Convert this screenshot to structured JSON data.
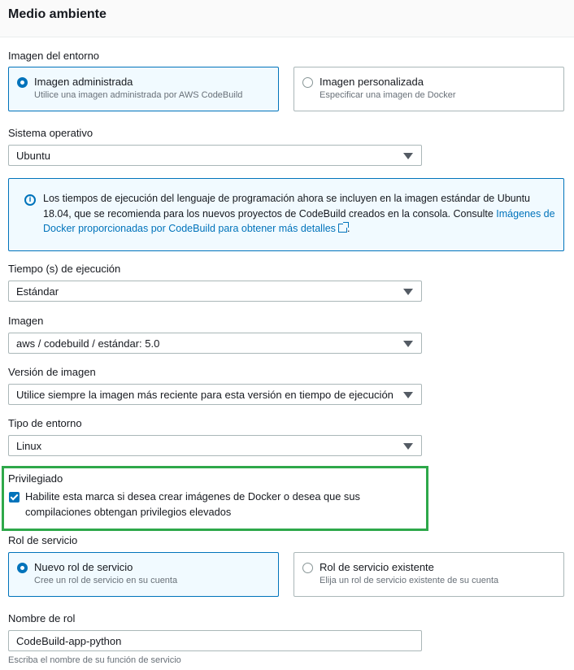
{
  "section": {
    "title": "Medio ambiente"
  },
  "image_env": {
    "label": "Imagen del entorno",
    "options": [
      {
        "title": "Imagen administrada",
        "desc": "Utilice una imagen administrada por AWS CodeBuild",
        "selected": true
      },
      {
        "title": "Imagen personalizada",
        "desc": "Especificar una imagen de Docker",
        "selected": false
      }
    ]
  },
  "os": {
    "label": "Sistema operativo",
    "value": "Ubuntu"
  },
  "info": {
    "text": "Los tiempos de ejecución del lenguaje de programación ahora se incluyen en la imagen estándar de Ubuntu 18.04, que se recomienda para los nuevos proyectos de CodeBuild creados en la consola. Consulte ",
    "link": "Imágenes de Docker proporcionadas por CodeBuild para obtener más detalles",
    "end": ".",
    "icon": "info-icon",
    "link_icon": "external-link-icon"
  },
  "runtime": {
    "label": "Tiempo (s) de ejecución",
    "value": "Estándar"
  },
  "image": {
    "label": "Imagen",
    "value": "aws / codebuild / estándar: 5.0"
  },
  "image_version": {
    "label": "Versión de imagen",
    "value": "Utilice siempre la imagen más reciente para esta versión en tiempo de ejecución"
  },
  "env_type": {
    "label": "Tipo de entorno",
    "value": "Linux"
  },
  "privileged": {
    "label": "Privilegiado",
    "checkbox_text": "Habilite esta marca si desea crear imágenes de Docker o desea que sus compilaciones obtengan privilegios elevados",
    "checked": true,
    "highlight_color": "#2ea84a"
  },
  "service_role": {
    "label": "Rol de servicio",
    "options": [
      {
        "title": "Nuevo rol de servicio",
        "desc": "Cree un rol de servicio en su cuenta",
        "selected": true
      },
      {
        "title": "Rol de servicio existente",
        "desc": "Elija un rol de servicio existente de su cuenta",
        "selected": false
      }
    ]
  },
  "role_name": {
    "label": "Nombre de rol",
    "value": "CodeBuild-app-python",
    "hint": "Escriba el nombre de su función de servicio"
  },
  "colors": {
    "accent": "#0073bb",
    "text": "#16191f",
    "muted": "#687078",
    "border": "#aab7b8"
  }
}
